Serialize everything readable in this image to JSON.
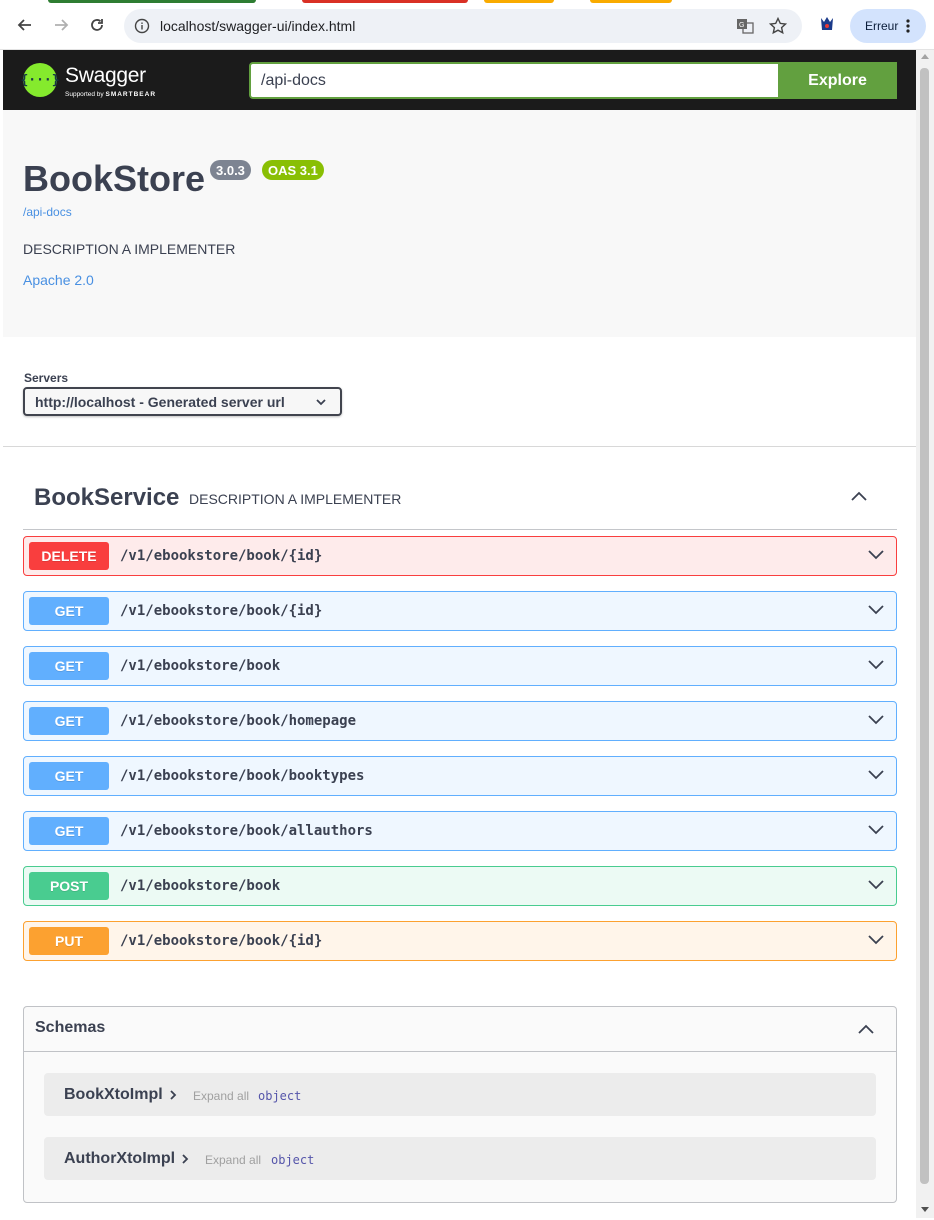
{
  "browser": {
    "url": "localhost/swagger-ui/index.html",
    "profile_label": "Erreur"
  },
  "swagger": {
    "brand": "Swagger",
    "brand_sub_prefix": "Supported by",
    "brand_sub_company": "SMARTBEAR",
    "search_value": "/api-docs",
    "explore_label": "Explore"
  },
  "info": {
    "title": "BookStore",
    "version": "3.0.3",
    "oas": "OAS 3.1",
    "url": "/api-docs",
    "description": "DESCRIPTION A IMPLEMENTER",
    "license": "Apache 2.0"
  },
  "servers": {
    "label": "Servers",
    "selected": "http://localhost - Generated server url"
  },
  "tag": {
    "name": "BookService",
    "description": "DESCRIPTION A IMPLEMENTER"
  },
  "operations": [
    {
      "method": "DELETE",
      "path": "/v1/ebookstore/book/{id}"
    },
    {
      "method": "GET",
      "path": "/v1/ebookstore/book/{id}"
    },
    {
      "method": "GET",
      "path": "/v1/ebookstore/book"
    },
    {
      "method": "GET",
      "path": "/v1/ebookstore/book/homepage"
    },
    {
      "method": "GET",
      "path": "/v1/ebookstore/book/booktypes"
    },
    {
      "method": "GET",
      "path": "/v1/ebookstore/book/allauthors"
    },
    {
      "method": "POST",
      "path": "/v1/ebookstore/book"
    },
    {
      "method": "PUT",
      "path": "/v1/ebookstore/book/{id}"
    }
  ],
  "schemas": {
    "title": "Schemas",
    "models": [
      {
        "name": "BookXtoImpl",
        "expand": "Expand all",
        "type": "object"
      },
      {
        "name": "AuthorXtoImpl",
        "expand": "Expand all",
        "type": "object"
      }
    ]
  },
  "colors": {
    "delete": "#f93e3e",
    "get": "#61affe",
    "post": "#49cc90",
    "put": "#fca130",
    "topbar": "#1b1b1b",
    "explore": "#62a03f"
  }
}
